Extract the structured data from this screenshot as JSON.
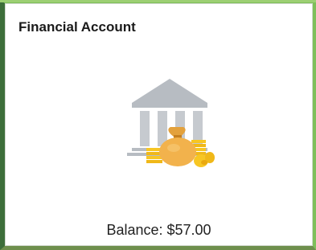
{
  "tile": {
    "title": "Financial Account",
    "balance_text": "Balance: $57.00",
    "icon": "bank-with-money-bag-icon"
  },
  "colors": {
    "border_green": "#7fbf5a",
    "border_dark_green": "#3d6e3a",
    "bank_gray": "#b7bcc2",
    "bag_orange": "#f2b24c",
    "coin_yellow": "#f7c623"
  }
}
